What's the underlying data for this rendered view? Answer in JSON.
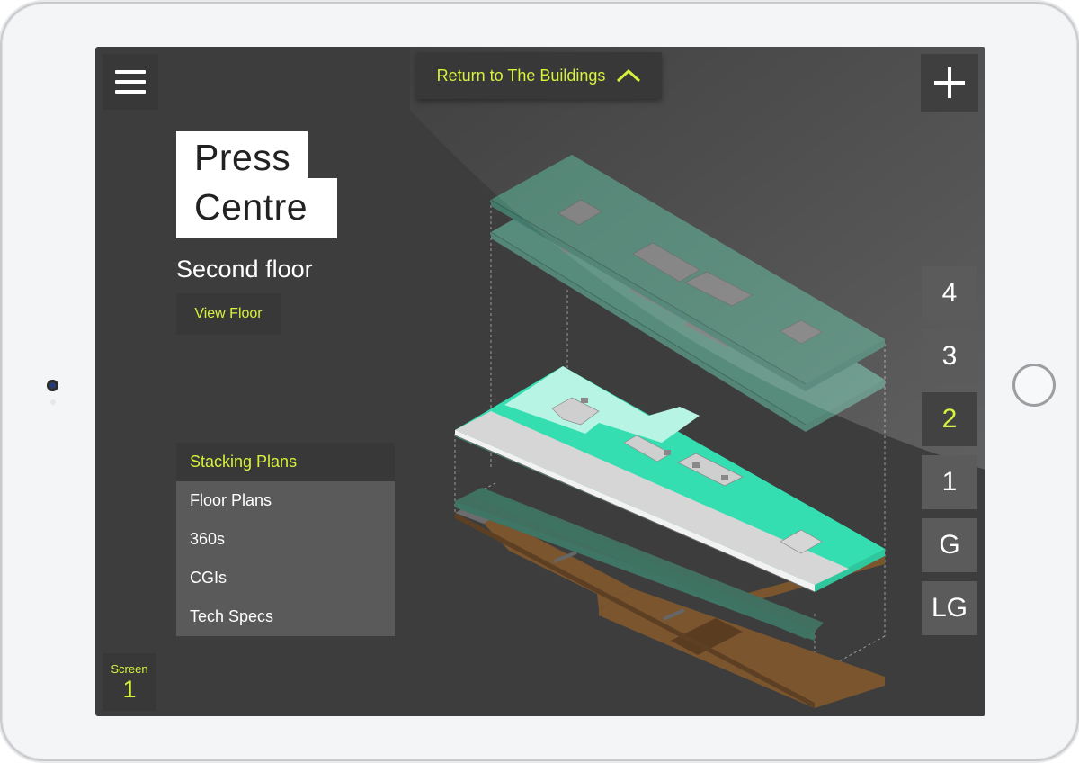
{
  "header": {
    "return_label": "Return to The Buildings",
    "return_icon": "chevron-up-icon",
    "menu_icon": "hamburger-menu-icon",
    "add_icon": "plus-icon"
  },
  "building": {
    "name_line1": "Press",
    "name_line2": "Centre",
    "floor_title": "Second floor",
    "view_floor_label": "View Floor"
  },
  "section_menu": {
    "active": "Stacking Plans",
    "items": [
      {
        "label": "Floor Plans"
      },
      {
        "label": "360s"
      },
      {
        "label": "CGIs"
      },
      {
        "label": "Tech Specs"
      }
    ]
  },
  "floor_selector": {
    "selected": "2",
    "floors": [
      {
        "label": "4"
      },
      {
        "label": "3"
      },
      {
        "label": "2"
      },
      {
        "label": "1"
      },
      {
        "label": "G"
      },
      {
        "label": "LG"
      }
    ]
  },
  "screen_indicator": {
    "label": "Screen",
    "number": "1"
  },
  "colors": {
    "accent": "#d8f23c",
    "background": "#3d3d3d",
    "panel": "#383838",
    "floor_upper": "#4e8a78",
    "floor_selected": "#34deb1",
    "floor_selected_light": "#b7f4e3",
    "floor_core": "#d6d6d6",
    "floor_lower": "#3f7564",
    "floor_basement": "#7a552e"
  }
}
